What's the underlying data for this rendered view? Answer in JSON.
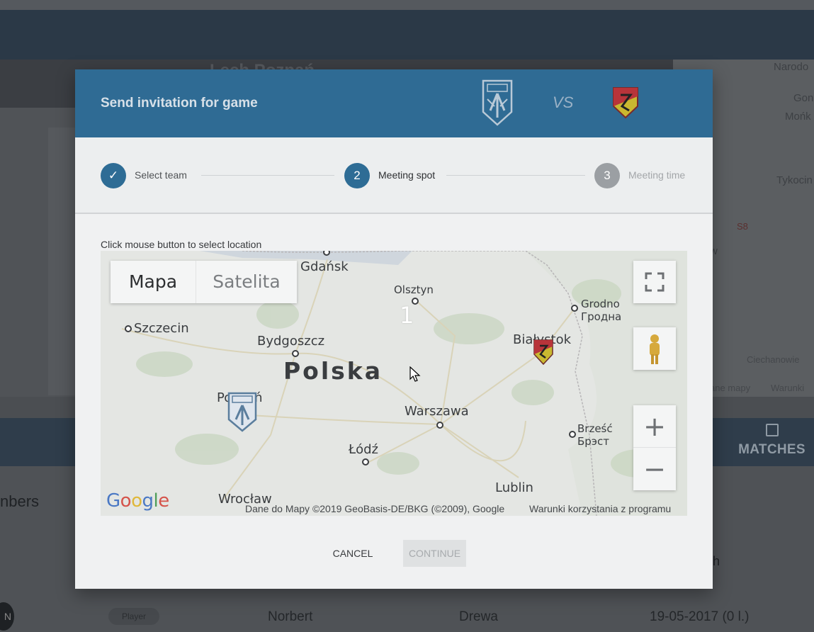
{
  "background": {
    "page_title": "Lech Poznań",
    "map_labels": [
      "Narodo",
      "Gon",
      "Mońk",
      "Tykocin",
      "Ciechanowie",
      "Warunki",
      "ane mapy",
      "w",
      "S8"
    ],
    "tab_matches": "MATCHES",
    "members_label": "nbers",
    "col_h": "h",
    "row": {
      "avatar": "N",
      "role": "Player",
      "first_name": "Norbert",
      "last_name": "Drewa",
      "date": "19-05-2017 (0 l.)"
    }
  },
  "modal": {
    "title": "Send invitation for game",
    "vs": "VS",
    "home_crest": "lech-poznan-crest",
    "away_crest": "jagiellonia-crest",
    "steps": [
      {
        "number": "✓",
        "label": "Select team",
        "state": "done"
      },
      {
        "number": "2",
        "label": "Meeting spot",
        "state": "active"
      },
      {
        "number": "3",
        "label": "Meeting time",
        "state": "inactive"
      }
    ],
    "hint": "Click mouse button to select location",
    "map": {
      "type_options": [
        "Mapa",
        "Satelita"
      ],
      "selected_type": "Mapa",
      "country": "Polska",
      "cluster_count": "1",
      "cities": {
        "gdansk": "Gdańsk",
        "olsztyn": "Olsztyn",
        "grodno1": "Grodno",
        "grodno2": "Гродна",
        "szczecin": "Szczecin",
        "bydgoszcz": "Bydgoszcz",
        "bialystok": "Białystok",
        "poznan": "Poznań",
        "warszawa": "Warszawa",
        "brzesc1": "Brześć",
        "brzesc2": "Брэст",
        "lodz": "Łódź",
        "wroclaw": "Wrocław",
        "lublin": "Lublin"
      },
      "zoom_in": "+",
      "zoom_out": "−",
      "attribution": "Dane do Mapy ©2019 GeoBasis-DE/BKG (©2009), Google",
      "terms": "Warunki korzystania z programu",
      "logo_letters": [
        "G",
        "o",
        "o",
        "g",
        "l",
        "e"
      ]
    },
    "actions": {
      "cancel": "CANCEL",
      "continue": "CONTINUE"
    }
  },
  "colors": {
    "header": "#2f6b94",
    "step_active": "#2e6c95",
    "step_inactive": "#9b9fa3"
  }
}
